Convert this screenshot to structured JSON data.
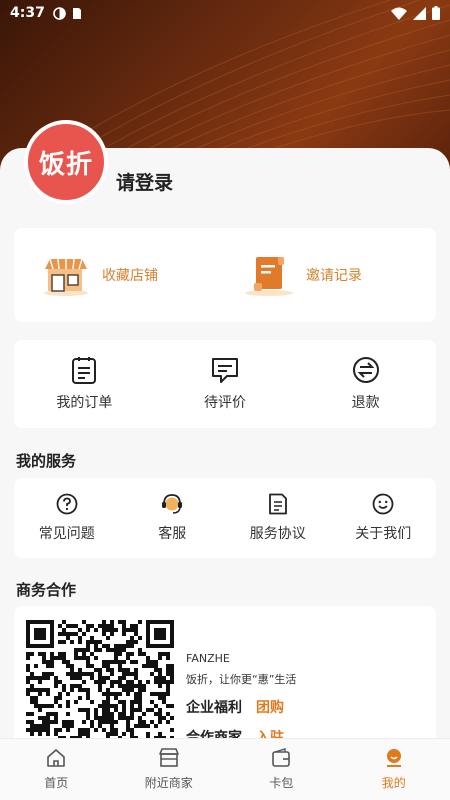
{
  "status_bar": {
    "time": "4:37"
  },
  "profile": {
    "avatar_text": "饭折",
    "login_text": "请登录"
  },
  "favorites": [
    {
      "label": "收藏店铺",
      "icon": "store-icon"
    },
    {
      "label": "邀请记录",
      "icon": "scroll-icon"
    }
  ],
  "orders": [
    {
      "label": "我的订单",
      "icon": "order-list-icon"
    },
    {
      "label": "待评价",
      "icon": "comment-icon"
    },
    {
      "label": "退款",
      "icon": "refund-icon"
    }
  ],
  "services": {
    "title": "我的服务",
    "items": [
      {
        "label": "常见问题",
        "icon": "question-icon"
      },
      {
        "label": "客服",
        "icon": "headset-icon"
      },
      {
        "label": "服务协议",
        "icon": "document-icon"
      },
      {
        "label": "关于我们",
        "icon": "smiley-icon"
      }
    ]
  },
  "business": {
    "title": "商务合作",
    "brand": "FANZHE",
    "slogan": "饭折，让你更“惠”生活",
    "row1_key": "企业福利",
    "row1_value": "团购",
    "row2_key": "合作商家",
    "row2_value": "入驻"
  },
  "tabs": [
    {
      "label": "首页",
      "icon": "home-icon"
    },
    {
      "label": "附近商家",
      "icon": "shop-icon"
    },
    {
      "label": "卡包",
      "icon": "wallet-icon"
    },
    {
      "label": "我的",
      "icon": "profile-icon",
      "active": true
    }
  ],
  "colors": {
    "accent": "#e07a1f",
    "avatar": "#e8554e"
  }
}
